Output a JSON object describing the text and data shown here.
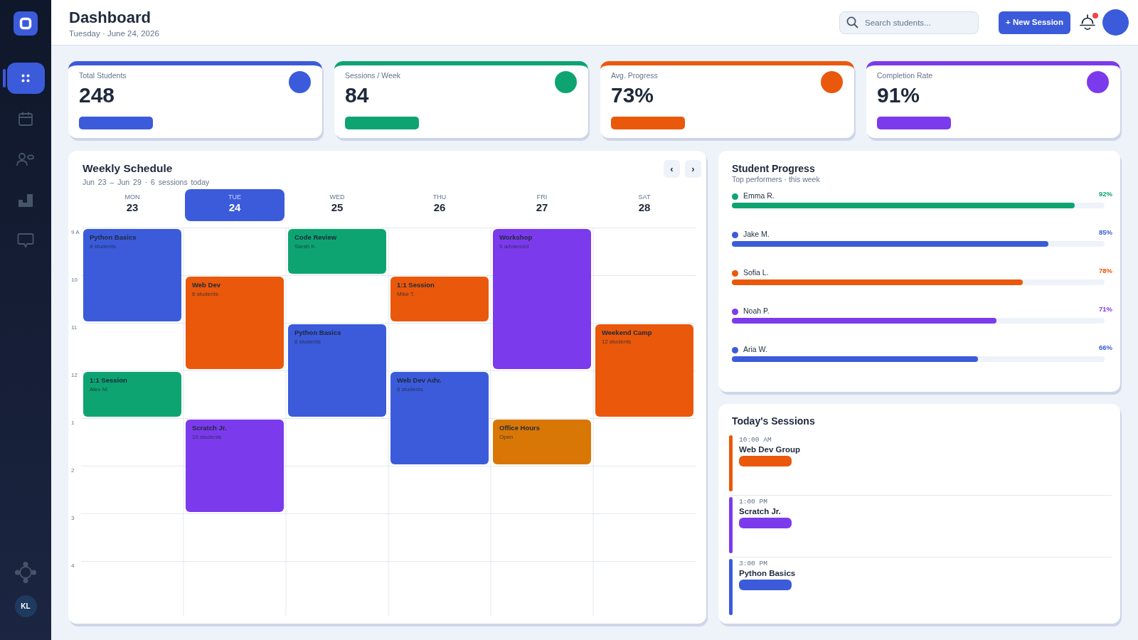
{
  "sidebar": {
    "nav": [
      {
        "selected": true
      },
      {
        "selected": false
      },
      {
        "selected": false
      },
      {
        "selected": false
      },
      {
        "selected": false
      }
    ],
    "user_initials": "KL"
  },
  "header": {
    "title": "Dashboard",
    "date": "Tuesday · June 24, 2026",
    "search": {
      "placeholder": "Search students..."
    },
    "new_session_button": "+ New Session",
    "notifications": {
      "unread": true
    }
  },
  "stats": [
    {
      "label": "Total Students",
      "value": "248",
      "color": "#3b5bdb"
    },
    {
      "label": "Sessions / Week",
      "value": "84",
      "color": "#0ea472"
    },
    {
      "label": "Avg. Progress",
      "value": "73%",
      "color": "#ea580c"
    },
    {
      "label": "Completion Rate",
      "value": "91%",
      "color": "#7c3aed"
    }
  ],
  "schedule": {
    "title": "Weekly Schedule",
    "subtitle": "Jun 23 – Jun 29 · 6 sessions today",
    "nav": [
      "‹",
      "›"
    ],
    "times": [
      "9 A",
      "10",
      "11",
      "12",
      "1",
      "2",
      "3",
      "4"
    ],
    "days": [
      {
        "name": "MON",
        "date": "23",
        "selected": false,
        "slots": [
          {
            "kind": "event",
            "title": "Python Basics",
            "subtitle": "8 students",
            "color": "#3b5bdb"
          },
          {
            "kind": "continued"
          },
          {
            "kind": "free"
          },
          {
            "kind": "event",
            "title": "1:1 Session",
            "subtitle": "Alex M.",
            "color": "#0ea472"
          },
          {
            "kind": "free"
          },
          {
            "kind": "free"
          },
          {
            "kind": "free"
          },
          {
            "kind": "free"
          }
        ]
      },
      {
        "name": "TUE",
        "date": "24",
        "selected": true,
        "slots": [
          {
            "kind": "free"
          },
          {
            "kind": "event",
            "title": "Web Dev",
            "subtitle": "6 students",
            "color": "#ea580c"
          },
          {
            "kind": "continued"
          },
          {
            "kind": "free"
          },
          {
            "kind": "event",
            "title": "Scratch Jr.",
            "subtitle": "10 students",
            "color": "#7c3aed"
          },
          {
            "kind": "continued"
          },
          {
            "kind": "free"
          },
          {
            "kind": "free"
          }
        ]
      },
      {
        "name": "WED",
        "date": "25",
        "selected": false,
        "slots": [
          {
            "kind": "event",
            "title": "Code Review",
            "subtitle": "Sarah K.",
            "color": "#0ea472"
          },
          {
            "kind": "free"
          },
          {
            "kind": "event",
            "title": "Python Basics",
            "subtitle": "8 students",
            "color": "#3b5bdb"
          },
          {
            "kind": "continued"
          },
          {
            "kind": "free"
          },
          {
            "kind": "free"
          },
          {
            "kind": "free"
          },
          {
            "kind": "free"
          }
        ]
      },
      {
        "name": "THU",
        "date": "26",
        "selected": false,
        "slots": [
          {
            "kind": "free"
          },
          {
            "kind": "event",
            "title": "1:1 Session",
            "subtitle": "Mike T.",
            "color": "#ea580c"
          },
          {
            "kind": "free"
          },
          {
            "kind": "event",
            "title": "Web Dev Adv.",
            "subtitle": "6 students",
            "color": "#3b5bdb"
          },
          {
            "kind": "continued"
          },
          {
            "kind": "free"
          },
          {
            "kind": "free"
          },
          {
            "kind": "free"
          }
        ]
      },
      {
        "name": "FRI",
        "date": "27",
        "selected": false,
        "slots": [
          {
            "kind": "event",
            "title": "Workshop",
            "subtitle": "5 advanced",
            "color": "#7c3aed"
          },
          {
            "kind": "continued"
          },
          {
            "kind": "continued"
          },
          {
            "kind": "free"
          },
          {
            "kind": "event",
            "title": "Office Hours",
            "subtitle": "Open",
            "color": "#d97706"
          },
          {
            "kind": "free"
          },
          {
            "kind": "free"
          },
          {
            "kind": "free"
          }
        ]
      },
      {
        "name": "SAT",
        "date": "28",
        "selected": false,
        "slots": [
          {
            "kind": "free"
          },
          {
            "kind": "free"
          },
          {
            "kind": "event",
            "title": "Weekend Camp",
            "subtitle": "12 students",
            "color": "#ea580c"
          },
          {
            "kind": "continued"
          },
          {
            "kind": "free"
          },
          {
            "kind": "free"
          },
          {
            "kind": "free"
          },
          {
            "kind": "free"
          }
        ]
      }
    ]
  },
  "progress": {
    "title": "Student Progress",
    "subtitle": "Top performers · this week",
    "students": [
      {
        "name": "Emma R.",
        "percent": "92%",
        "level": 0.92,
        "color": "#0ea472"
      },
      {
        "name": "Jake M.",
        "percent": "85%",
        "level": 0.85,
        "color": "#3b5bdb"
      },
      {
        "name": "Sofia L.",
        "percent": "78%",
        "level": 0.78,
        "color": "#ea580c"
      },
      {
        "name": "Noah P.",
        "percent": "71%",
        "level": 0.71,
        "color": "#7c3aed"
      },
      {
        "name": "Aria W.",
        "percent": "66%",
        "level": 0.66,
        "color": "#3b5bdb"
      }
    ]
  },
  "sessions": {
    "title": "Today's Sessions",
    "items": [
      {
        "time": "10:00 AM",
        "title": "Web Dev Group",
        "color": "#ea580c"
      },
      {
        "time": "1:00 PM",
        "title": "Scratch Jr.",
        "color": "#7c3aed"
      },
      {
        "time": "3:00 PM",
        "title": "Python Basics",
        "color": "#3b5bdb"
      }
    ]
  }
}
